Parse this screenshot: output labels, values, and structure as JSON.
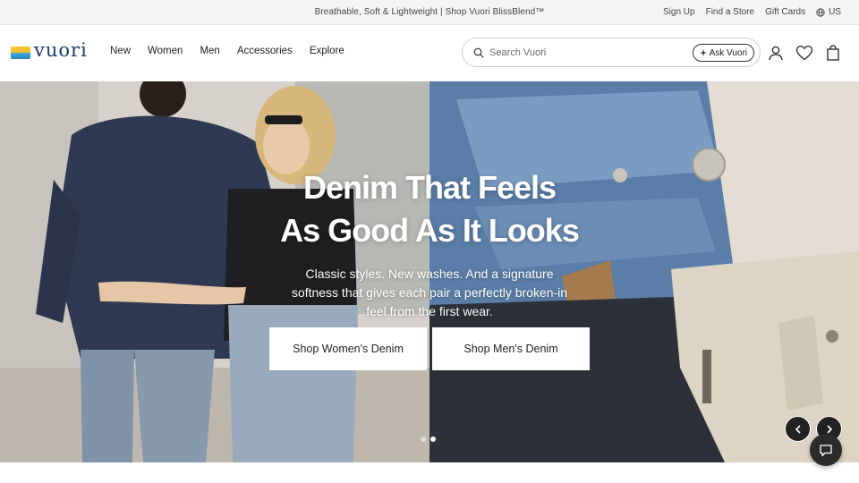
{
  "topbar": {
    "promo": "Breathable, Soft & Lightweight | Shop Vuori BlissBlend™",
    "sign_up": "Sign Up",
    "find_store": "Find a Store",
    "gift_cards": "Gift Cards",
    "region": "US"
  },
  "header": {
    "logo_text": "vuori",
    "nav": [
      "New",
      "Women",
      "Men",
      "Accessories",
      "Explore"
    ],
    "search_placeholder": "Search Vuori",
    "ask_label": "Ask Vuori",
    "icons": [
      "account-icon",
      "heart-icon",
      "bag-icon"
    ]
  },
  "hero": {
    "title_line1": "Denim That Feels",
    "title_line2": "As Good As It Looks",
    "subtitle": "Classic styles. New washes. And a signature softness that gives each pair a perfectly broken-in feel from the first wear.",
    "cta_women": "Shop Women's Denim",
    "cta_men": "Shop Men's Denim",
    "slide_count": 2,
    "active_slide": 2
  },
  "colors": {
    "logo_blue": "#1a3a6b",
    "logo_yellow": "#f2c230",
    "logo_cyan": "#3aa9d6",
    "dark_button": "#222222"
  }
}
